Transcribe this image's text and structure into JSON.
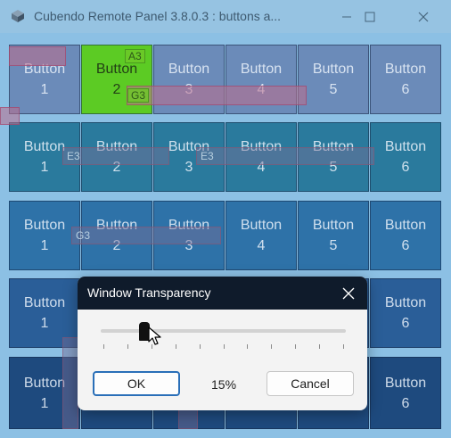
{
  "window": {
    "title": "Cubendo Remote Panel 3.8.0.3 : buttons a...",
    "controls": [
      "minimize-icon",
      "maximize-icon",
      "close-icon"
    ]
  },
  "grid": {
    "rows": [
      {
        "buttons": [
          {
            "line1": "Button",
            "line2": "1"
          },
          {
            "line1": "Button",
            "line2": "2",
            "state": "active"
          },
          {
            "line1": "Button",
            "line2": "3"
          },
          {
            "line1": "Button",
            "line2": "4"
          },
          {
            "line1": "Button",
            "line2": "5"
          },
          {
            "line1": "Button",
            "line2": "6"
          }
        ]
      },
      {
        "buttons": [
          {
            "line1": "Button",
            "line2": "1"
          },
          {
            "line1": "Button",
            "line2": "2"
          },
          {
            "line1": "Button",
            "line2": "3"
          },
          {
            "line1": "Button",
            "line2": "4"
          },
          {
            "line1": "Button",
            "line2": "5"
          },
          {
            "line1": "Button",
            "line2": "6"
          }
        ]
      },
      {
        "buttons": [
          {
            "line1": "Button",
            "line2": "1"
          },
          {
            "line1": "Button",
            "line2": "2"
          },
          {
            "line1": "Button",
            "line2": "3"
          },
          {
            "line1": "Button",
            "line2": "4"
          },
          {
            "line1": "Button",
            "line2": "5"
          },
          {
            "line1": "Button",
            "line2": "6"
          }
        ]
      },
      {
        "buttons": [
          {
            "line1": "Button",
            "line2": "1"
          },
          {
            "line1": "Button",
            "line2": "6"
          }
        ]
      },
      {
        "buttons": [
          {
            "line1": "Button",
            "line2": "1"
          },
          {
            "line1": "Button",
            "line2": "6"
          }
        ]
      }
    ],
    "overlay_tags": [
      "A3",
      "G3",
      "E3",
      "E3",
      "G3"
    ]
  },
  "dialog": {
    "title": "Window Transparency",
    "slider": {
      "value_percent": 15,
      "min": 0,
      "max": 100,
      "tick_count": 11
    },
    "value_label": "15%",
    "ok_label": "OK",
    "cancel_label": "Cancel"
  },
  "colors": {
    "active_button": "#5ccb24",
    "dialog_header": "#0f1b2b",
    "ok_border": "#2a6fb8"
  }
}
